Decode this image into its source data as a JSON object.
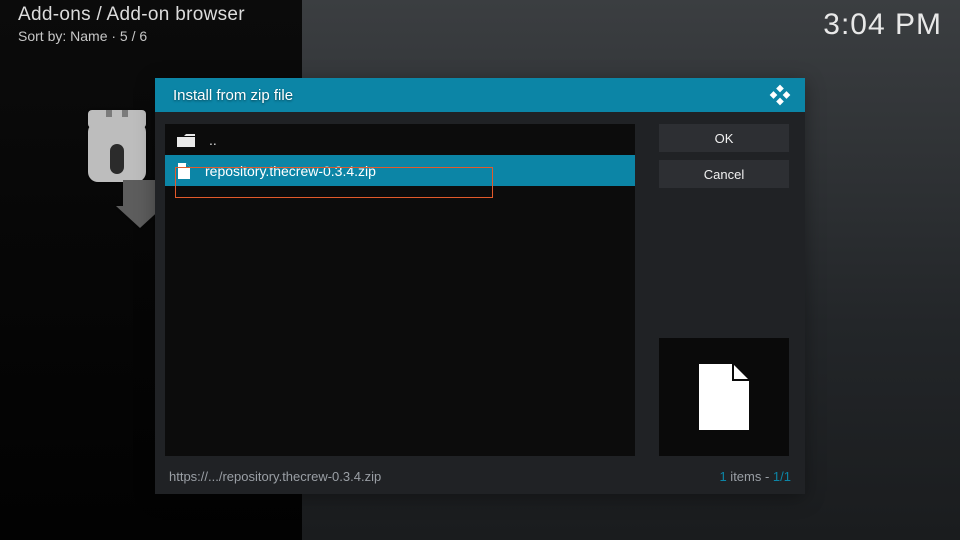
{
  "header": {
    "breadcrumb": "Add-ons / Add-on browser",
    "sort_line": "Sort by: Name  ·  5 / 6",
    "clock": "3:04 PM"
  },
  "dialog": {
    "title": "Install from zip file",
    "files": {
      "parent_label": "..",
      "selected_label": "repository.thecrew-0.3.4.zip"
    },
    "buttons": {
      "ok": "OK",
      "cancel": "Cancel"
    },
    "footer": {
      "path": "https://.../repository.thecrew-0.3.4.zip",
      "count_current": "1",
      "count_items_word": " items - ",
      "count_pos": "1/1"
    }
  },
  "colors": {
    "accent": "#0c85a6",
    "highlight_border": "#e25a2b"
  }
}
